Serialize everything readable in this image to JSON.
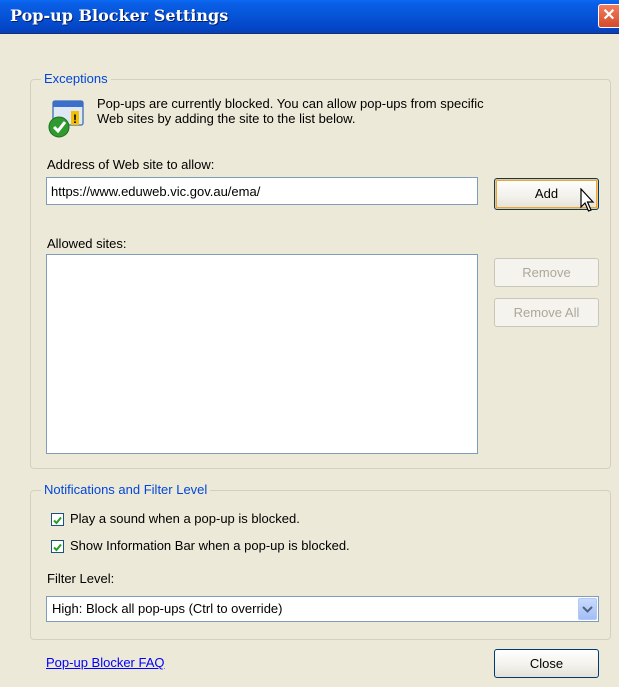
{
  "window": {
    "title": "Pop-up Blocker Settings",
    "close_glyph": "✕"
  },
  "exceptions": {
    "legend": "Exceptions",
    "info_icon": "shield-warning-icon",
    "info_line1": "Pop-ups are currently blocked.  You can allow pop-ups from specific",
    "info_line2": "Web sites by adding the site to the list below.",
    "address_label": "Address of Web site to allow:",
    "address_value": "https://www.eduweb.vic.gov.au/ema/",
    "add_label": "Add",
    "allowed_label": "Allowed sites:",
    "allowed_sites": [],
    "remove_label": "Remove",
    "remove_all_label": "Remove All"
  },
  "notifications": {
    "legend": "Notifications and Filter Level",
    "play_sound_label": "Play a sound when a pop-up is blocked.",
    "play_sound_checked": true,
    "show_bar_label": "Show Information Bar when a pop-up is blocked.",
    "show_bar_checked": true,
    "filter_level_label": "Filter Level:",
    "filter_level_value": "High: Block all pop-ups (Ctrl to override)"
  },
  "footer": {
    "faq_link": "Pop-up Blocker FAQ",
    "close_label": "Close"
  },
  "colors": {
    "title_bar": "#0653d6",
    "dialog_bg": "#ece9d8",
    "legend_text": "#0047d9",
    "link": "#0000ff",
    "check_mark": "#21a121"
  }
}
